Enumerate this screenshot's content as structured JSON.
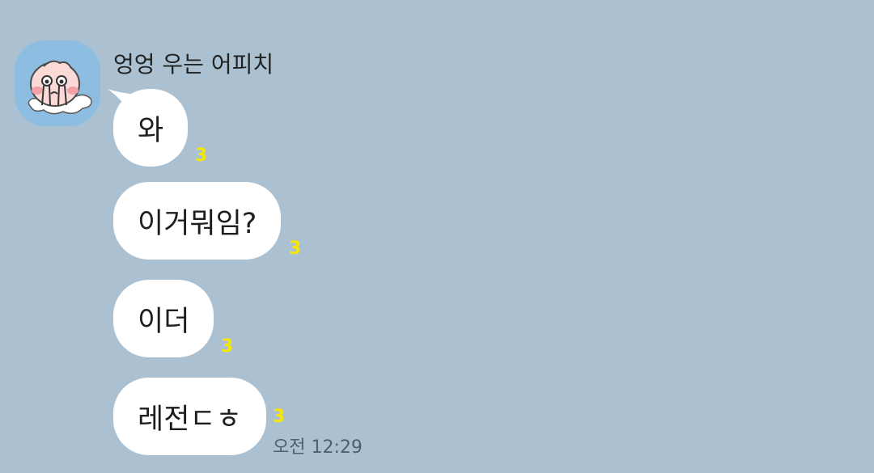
{
  "chat": {
    "sender": {
      "name": "엉엉 우는 어피치",
      "avatar": "crying-apeach-icon"
    },
    "messages": [
      {
        "text": "와",
        "unread": "3",
        "time": ""
      },
      {
        "text": "이거뭐임?",
        "unread": "3",
        "time": ""
      },
      {
        "text": "이더",
        "unread": "3",
        "time": ""
      },
      {
        "text": "레전ㄷㅎ",
        "unread": "3",
        "time": "오전 12:29"
      }
    ]
  },
  "colors": {
    "background": "#abc1d1",
    "bubble": "#ffffff",
    "unread": "#f7e600",
    "avatar_bg": "#8dbde0"
  }
}
